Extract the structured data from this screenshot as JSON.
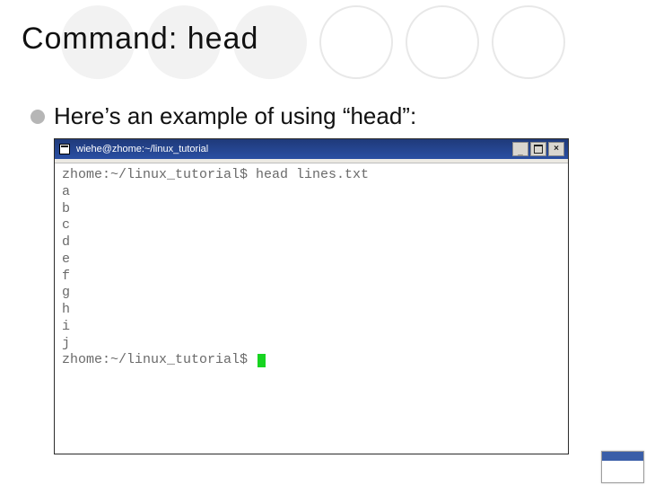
{
  "slide": {
    "title": "Command: head",
    "bullet": "Here’s an example of using “head”:"
  },
  "terminal": {
    "titlebar": "wiehe@zhome:~/linux_tutorial",
    "prompt1": "zhome:~/linux_tutorial$ head lines.txt",
    "output": [
      "a",
      "b",
      "c",
      "d",
      "e",
      "f",
      "g",
      "h",
      "i",
      "j"
    ],
    "prompt2": "zhome:~/linux_tutorial$ "
  }
}
